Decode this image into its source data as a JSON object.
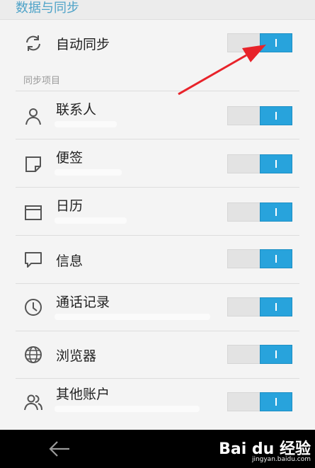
{
  "header": {
    "title": "数据与同步"
  },
  "auto_sync": {
    "label": "自动同步",
    "on": true,
    "icon": "sync-icon"
  },
  "section": {
    "label": "同步项目"
  },
  "items": [
    {
      "label": "联系人",
      "icon": "person-icon",
      "on": true
    },
    {
      "label": "便签",
      "icon": "note-icon",
      "on": true
    },
    {
      "label": "日历",
      "icon": "calendar-icon",
      "on": true
    },
    {
      "label": "信息",
      "icon": "message-icon",
      "on": true
    },
    {
      "label": "通话记录",
      "icon": "clock-icon",
      "on": true
    },
    {
      "label": "浏览器",
      "icon": "globe-icon",
      "on": true
    },
    {
      "label": "其他账户",
      "icon": "people-icon",
      "on": true
    }
  ],
  "navbar": {
    "back_icon": "back-arrow-icon"
  },
  "watermark": {
    "brand": "Bai du 经验",
    "url": "jingyan.baidu.com"
  },
  "colors": {
    "accent": "#28a3dc",
    "header_text": "#4fa3c8",
    "annotation_arrow": "#e8232a"
  }
}
